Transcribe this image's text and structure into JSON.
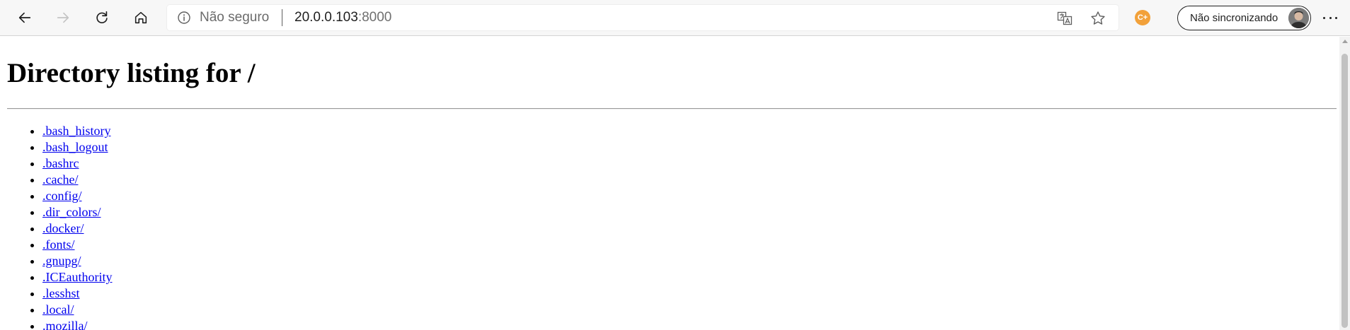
{
  "browser": {
    "back_icon": "arrow-left-icon",
    "forward_icon": "arrow-right-icon",
    "refresh_icon": "refresh-icon",
    "home_icon": "home-icon",
    "omnibox": {
      "security_label": "Não seguro",
      "url_host": "20.0.0.103",
      "url_port": ":8000"
    },
    "extension_label": "C+",
    "profile_label": "Não sincronizando"
  },
  "page": {
    "title": "Directory listing for /",
    "entries": [
      ".bash_history",
      ".bash_logout",
      ".bashrc",
      ".cache/",
      ".config/",
      ".dir_colors/",
      ".docker/",
      ".fonts/",
      ".gnupg/",
      ".ICEauthority",
      ".lesshst",
      ".local/",
      ".mozilla/"
    ]
  },
  "colors": {
    "link": "#0000ee",
    "toolbar_bg": "#f7f7f7",
    "extension_accent": "#f2a13a"
  }
}
